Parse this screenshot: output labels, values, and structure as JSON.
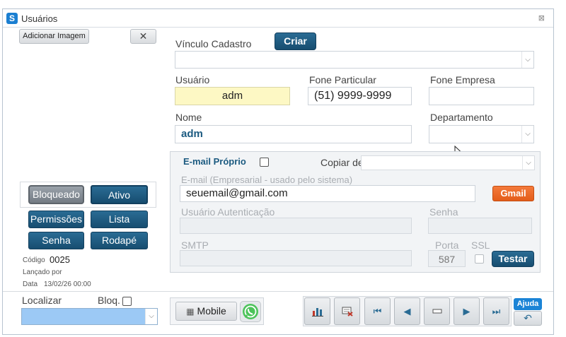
{
  "window": {
    "title": "Usuários",
    "app_icon": "S",
    "close_glyph": "⊠"
  },
  "left_panel": {
    "add_image_label": "Adicionar Imagem",
    "remove_glyph": "✕",
    "status": {
      "bloqueado_label": "Bloqueado",
      "ativo_label": "Ativo"
    },
    "buttons": {
      "permissoes": "Permissões",
      "lista": "Lista",
      "senha": "Senha",
      "rodape": "Rodapé"
    },
    "info": {
      "codigo_label": "Código",
      "codigo_value": "0025",
      "lancado_label": "Lançado por",
      "lancado_value": "",
      "data_label": "Data",
      "data_value": "13/02/26 00:00"
    }
  },
  "form": {
    "vinculo_label": "Vínculo Cadastro",
    "criar_label": "Criar",
    "vinculo_value": "",
    "usuario_label": "Usuário",
    "usuario_value": "adm",
    "fone_particular_label": "Fone Particular",
    "fone_particular_value": "(51) 9999-9999",
    "fone_empresa_label": "Fone Empresa",
    "fone_empresa_value": "",
    "nome_label": "Nome",
    "nome_value": "adm",
    "departamento_label": "Departamento",
    "departamento_value": ""
  },
  "email": {
    "email_proprio_label": "E-mail Próprio",
    "email_proprio_checked": false,
    "copiar_label": "Copiar de",
    "copiar_value": "",
    "email_label": "E-mail (Empresarial - usado pelo sistema)",
    "email_value": "seuemail@gmail.com",
    "gmail_label": "Gmail",
    "usuario_auth_label": "Usuário Autenticação",
    "senha_label": "Senha",
    "smtp_label": "SMTP",
    "porta_label": "Porta",
    "porta_value": "587",
    "ssl_label": "SSL",
    "testar_label": "Testar"
  },
  "bottom": {
    "localizar_label": "Localizar",
    "bloq_label": "Bloq.",
    "localizar_value": "",
    "mobile_label": "Mobile",
    "ajuda_label": "Ajuda"
  },
  "colors": {
    "accent": "#1b5a80",
    "highlight_field": "#fdf8c4",
    "localizar_bg": "#9cc9f5",
    "gmail": "#ee6a2a"
  }
}
